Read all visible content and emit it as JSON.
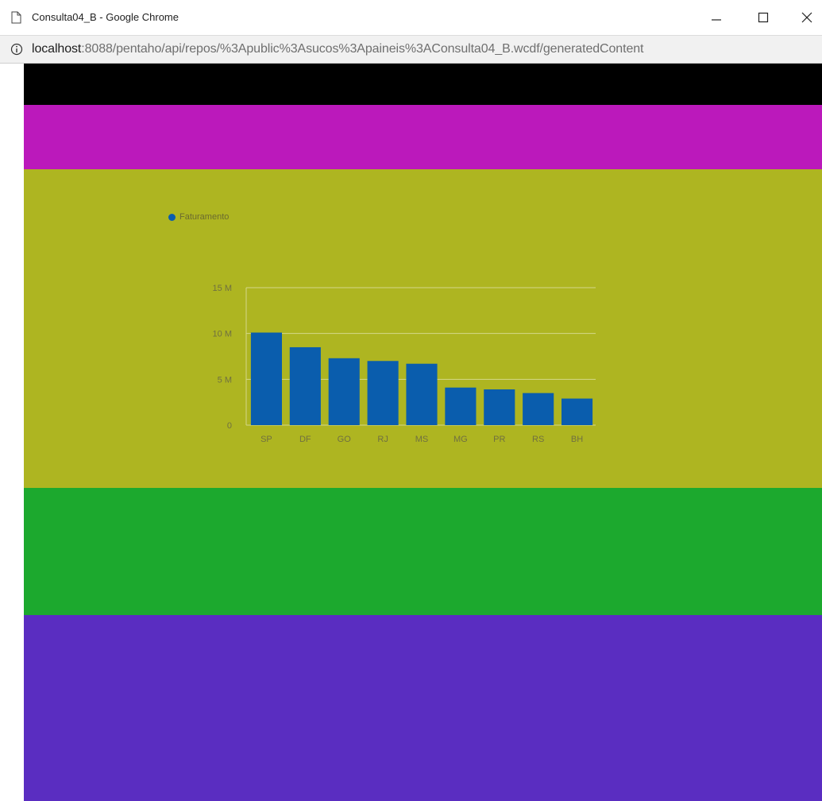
{
  "window": {
    "title": "Consulta04_B - Google Chrome",
    "controls": {
      "minimize": "–",
      "maximize": "☐",
      "close": "✕"
    }
  },
  "address_bar": {
    "host": "localhost",
    "rest": ":8088/pentaho/api/repos/%3Apublic%3Asucos%3Apaineis%3AConsulta04_B.wcdf/generatedContent"
  },
  "colors": {
    "band_black": "#000000",
    "band_magenta": "#bb19bb",
    "band_olive": "#aeb521",
    "band_green": "#1ca92e",
    "band_purple": "#5a2dc1",
    "bar": "#0a5dad",
    "grid": "#d4d88a"
  },
  "chart_data": {
    "type": "bar",
    "title": "",
    "xlabel": "",
    "ylabel": "",
    "legend": {
      "position": "top-left",
      "entries": [
        "Faturamento"
      ]
    },
    "categories": [
      "SP",
      "DF",
      "GO",
      "RJ",
      "MS",
      "MG",
      "PR",
      "RS",
      "BH"
    ],
    "series": [
      {
        "name": "Faturamento",
        "values": [
          10.1,
          8.5,
          7.3,
          7.0,
          6.7,
          4.1,
          3.9,
          3.5,
          2.9
        ]
      }
    ],
    "ylim": [
      0,
      15
    ],
    "yticks": [
      {
        "value": 0,
        "label": "0"
      },
      {
        "value": 5,
        "label": "5 M"
      },
      {
        "value": 10,
        "label": "10 M"
      },
      {
        "value": 15,
        "label": "15 M"
      }
    ],
    "grid": true
  }
}
